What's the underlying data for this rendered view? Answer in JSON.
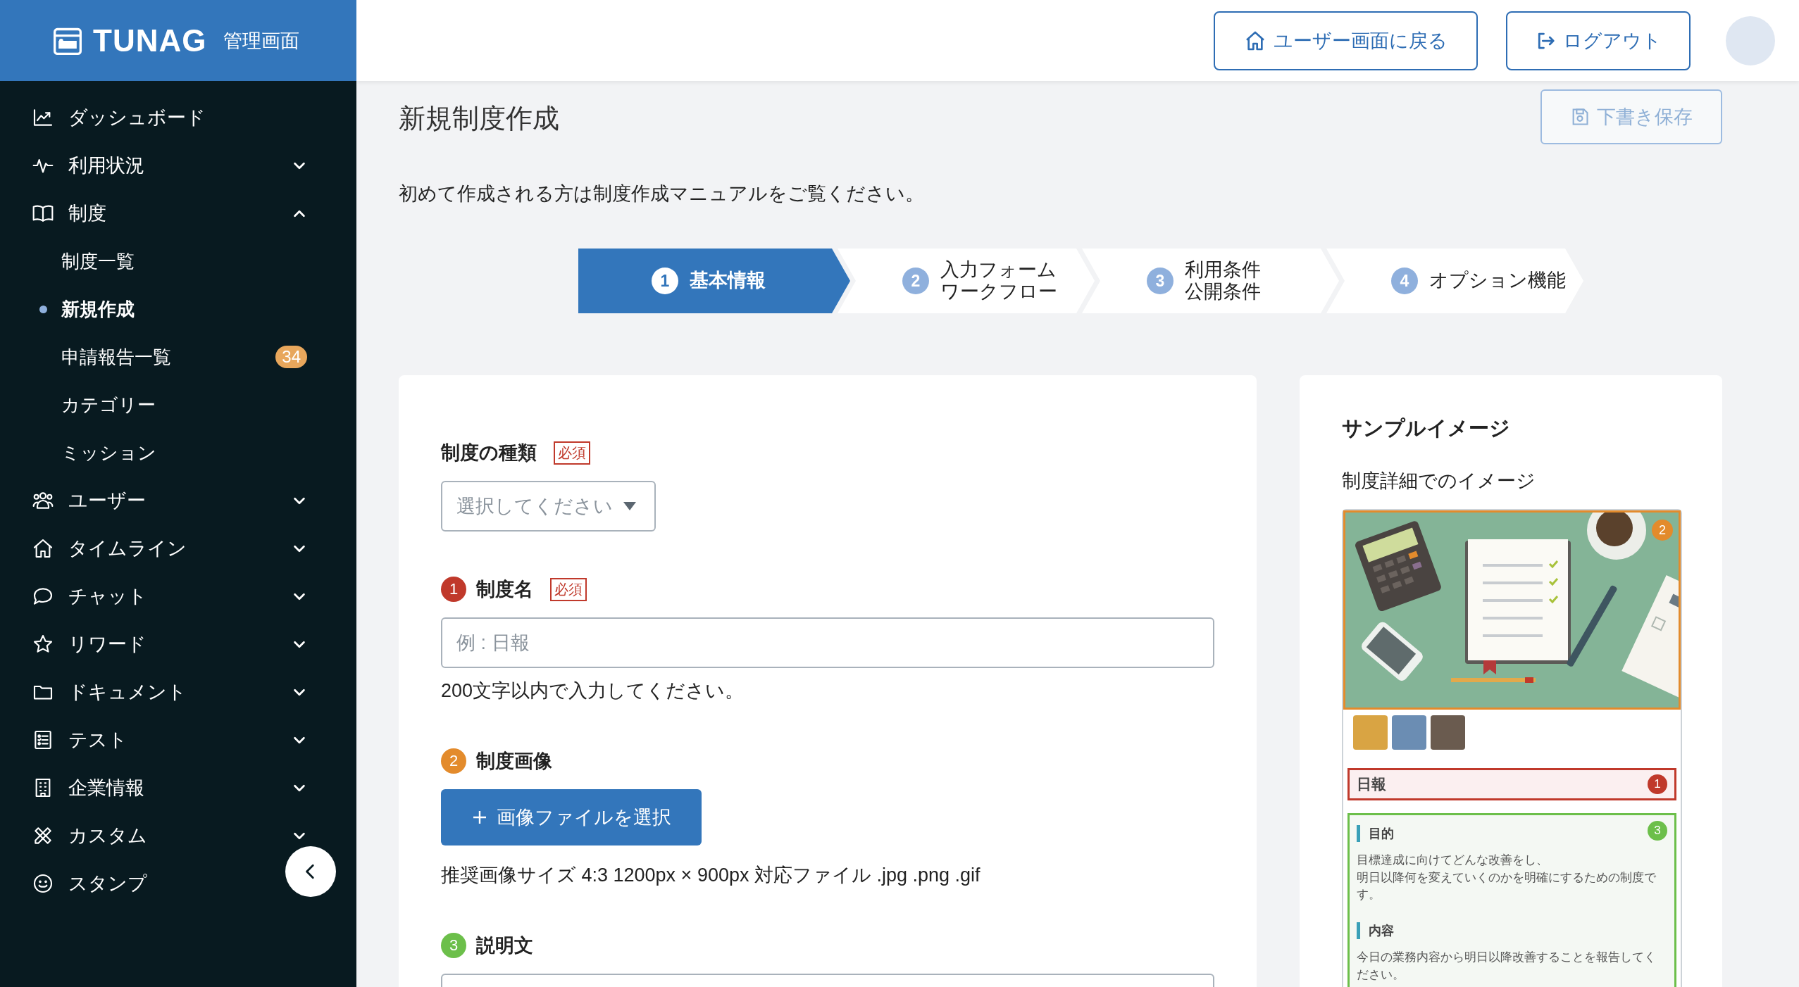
{
  "sidebar": {
    "logo_text": "TUNAG",
    "logo_subtitle": "管理画面",
    "items": [
      {
        "label": "ダッシュボード"
      },
      {
        "label": "利用状況",
        "expanded": false
      },
      {
        "label": "制度",
        "expanded": true,
        "children": [
          {
            "label": "制度一覧",
            "selected": false
          },
          {
            "label": "新規作成",
            "selected": true
          },
          {
            "label": "申請報告一覧",
            "selected": false,
            "badge": "34"
          },
          {
            "label": "カテゴリー",
            "selected": false
          },
          {
            "label": "ミッション",
            "selected": false
          }
        ]
      },
      {
        "label": "ユーザー",
        "expanded": false
      },
      {
        "label": "タイムライン",
        "expanded": false
      },
      {
        "label": "チャット",
        "expanded": false
      },
      {
        "label": "リワード",
        "expanded": false
      },
      {
        "label": "ドキュメント",
        "expanded": false
      },
      {
        "label": "テスト",
        "expanded": false
      },
      {
        "label": "企業情報",
        "expanded": false
      },
      {
        "label": "カスタム",
        "expanded": false
      },
      {
        "label": "スタンプ"
      }
    ]
  },
  "header": {
    "back_button": "ユーザー画面に戻る",
    "logout_button": "ログアウト"
  },
  "page": {
    "title": "新規制度作成",
    "draft_button": {
      "label": "下書き保存",
      "disabled": true
    },
    "notice": "初めて作成される方は制度作成マニュアルをご覧ください。"
  },
  "steps": [
    {
      "number": "1",
      "lines": [
        "基本情報"
      ],
      "selected": true
    },
    {
      "number": "2",
      "lines": [
        "入力フォーム",
        "ワークフロー"
      ],
      "selected": false
    },
    {
      "number": "3",
      "lines": [
        "利用条件",
        "公開条件"
      ],
      "selected": false
    },
    {
      "number": "4",
      "lines": [
        "オプション機能"
      ],
      "selected": false
    }
  ],
  "form": {
    "fields": [
      {
        "kind": "select",
        "label": "制度の種類",
        "required_badge": "必須",
        "placeholder": "選択してください"
      },
      {
        "kind": "text",
        "number": "1",
        "color": "#c0392b",
        "label": "制度名",
        "required_badge": "必須",
        "placeholder": "例 : 日報",
        "help": "200文字以内で入力してください。"
      },
      {
        "kind": "file",
        "number": "2",
        "color": "#e38b2c",
        "label": "制度画像",
        "button": "画像ファイルを選択",
        "help": "推奨画像サイズ 4:3 1200px × 900px 対応ファイル .jpg .png .gif"
      },
      {
        "kind": "textarea",
        "number": "3",
        "color": "#6cbf4a",
        "label": "説明文"
      }
    ]
  },
  "sample": {
    "title": "サンプルイメージ",
    "subtitle": "制度詳細でのイメージ",
    "image_marker": {
      "number": "2",
      "color": "#e38b2c"
    },
    "title_marker": {
      "number": "1",
      "color": "#c0392b"
    },
    "preview_title": "日報",
    "content_marker": {
      "number": "3",
      "color": "#6cbf4a"
    },
    "sections": [
      {
        "heading": "目的",
        "lines": [
          "目標達成に向けてどんな改善をし、",
          "明日以降何を変えていくのかを明確にするための制度です。"
        ]
      },
      {
        "heading": "内容",
        "lines": [
          "今日の業務内容から明日以降改善することを報告してください。"
        ]
      }
    ]
  }
}
